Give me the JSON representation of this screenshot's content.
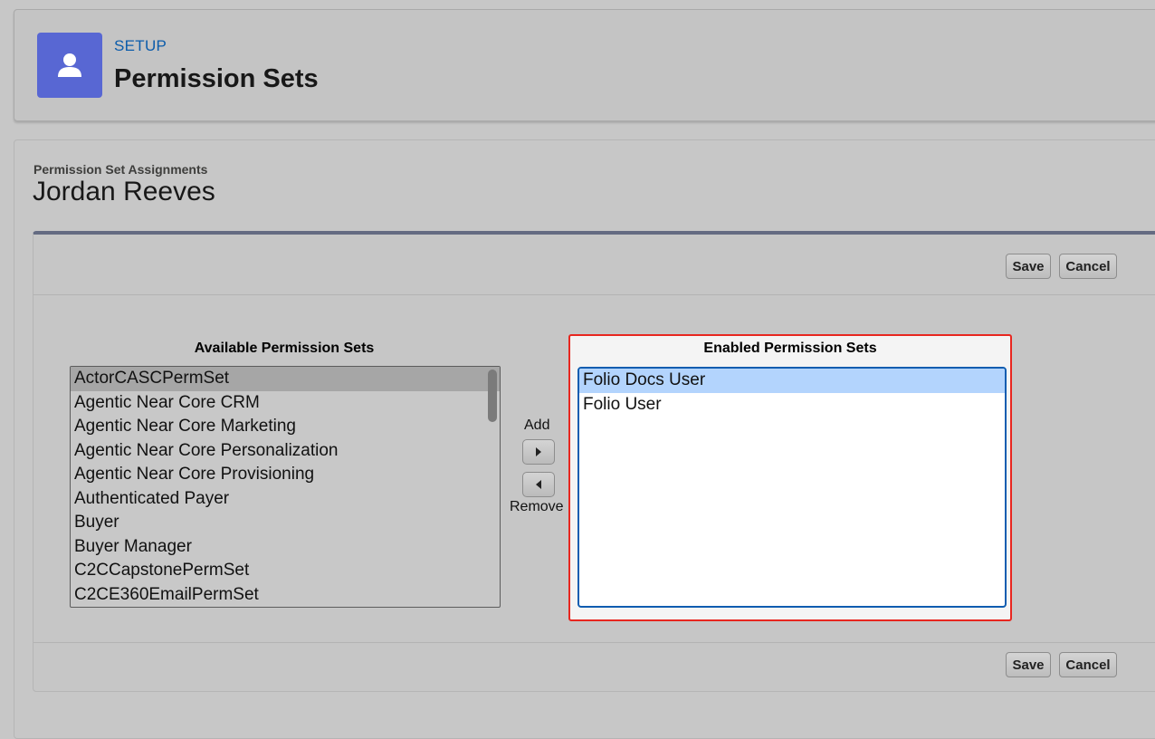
{
  "header": {
    "setup_label": "SETUP",
    "title": "Permission Sets",
    "icon": "user-icon",
    "icon_color": "#5867d3"
  },
  "assignment": {
    "section_label": "Permission Set Assignments",
    "user_name": "Jordan Reeves"
  },
  "buttons": {
    "save": "Save",
    "cancel": "Cancel",
    "add": "Add",
    "remove": "Remove"
  },
  "available": {
    "title": "Available Permission Sets",
    "selected_index": 0,
    "items": [
      "ActorCASCPermSet",
      "Agentic Near Core CRM",
      "Agentic Near Core Marketing",
      "Agentic Near Core Personalization",
      "Agentic Near Core Provisioning",
      "Authenticated Payer",
      "Buyer",
      "Buyer Manager",
      "C2CCapstonePermSet",
      "C2CE360EmailPermSet"
    ]
  },
  "enabled": {
    "title": "Enabled Permission Sets",
    "selected_index": 0,
    "highlight_color": "#e8261f",
    "items": [
      "Folio Docs User",
      "Folio User"
    ]
  }
}
